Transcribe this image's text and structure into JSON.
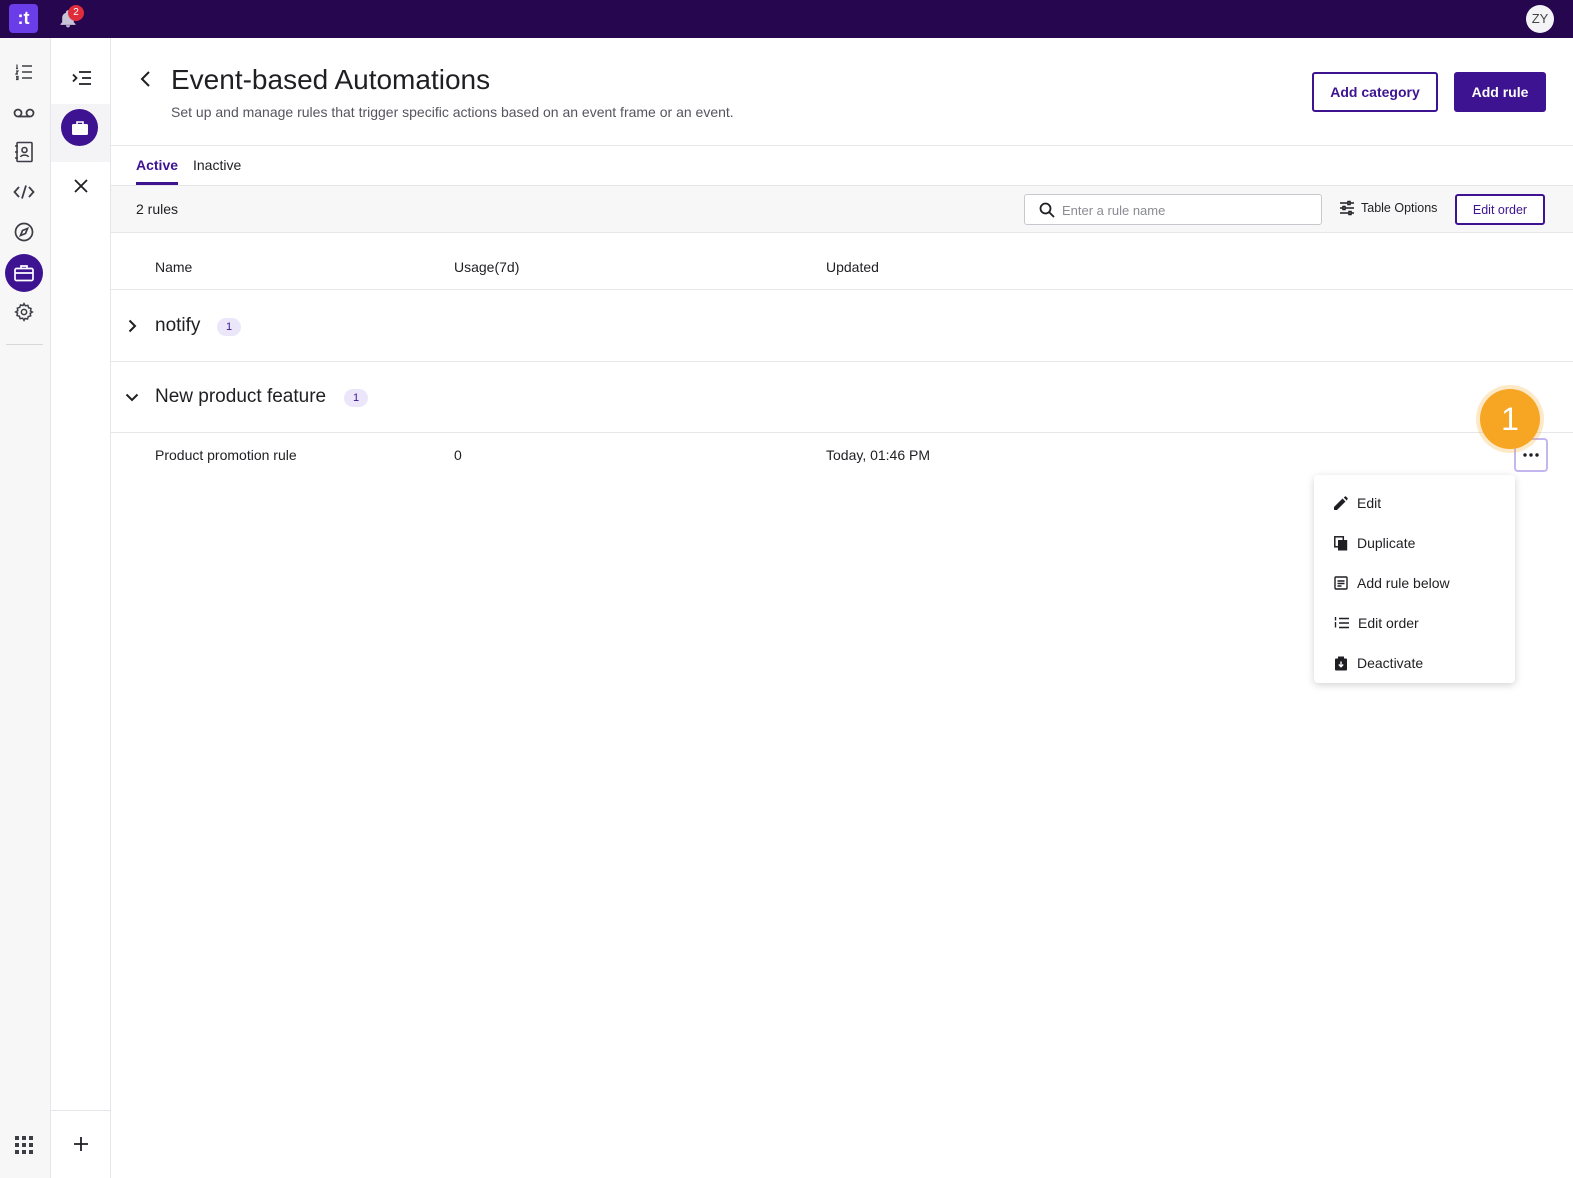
{
  "topbar": {
    "logo_text": ":t",
    "notification_count": "2",
    "user_initials": "ZY"
  },
  "header": {
    "title": "Event-based Automations",
    "subtitle": "Set up and manage rules that trigger specific actions based on an event frame or an event.",
    "add_category_label": "Add category",
    "add_rule_label": "Add rule"
  },
  "tabs": [
    {
      "label": "Active",
      "active": true
    },
    {
      "label": "Inactive",
      "active": false
    }
  ],
  "toolbar": {
    "rule_count": "2 rules",
    "search_placeholder": "Enter a rule name",
    "table_options_label": "Table Options",
    "edit_order_label": "Edit order"
  },
  "table": {
    "columns": [
      "Name",
      "Usage(7d)",
      "Updated"
    ],
    "groups": [
      {
        "name": "notify",
        "count": "1",
        "expanded": false
      },
      {
        "name": "New product feature",
        "count": "1",
        "expanded": true
      }
    ],
    "rows": [
      {
        "name": "Product promotion rule",
        "usage": "0",
        "updated": "Today, 01:46 PM"
      }
    ]
  },
  "step_marker": "1",
  "context_menu": {
    "items": [
      {
        "label": "Edit",
        "icon": "pencil-icon"
      },
      {
        "label": "Duplicate",
        "icon": "copy-icon"
      },
      {
        "label": "Add rule below",
        "icon": "add-below-icon"
      },
      {
        "label": "Edit order",
        "icon": "ordered-list-icon"
      },
      {
        "label": "Deactivate",
        "icon": "deactivate-icon"
      }
    ]
  },
  "colors": {
    "topbar": "#25064f",
    "primary": "#3d1391",
    "step_marker": "#f6a623"
  }
}
